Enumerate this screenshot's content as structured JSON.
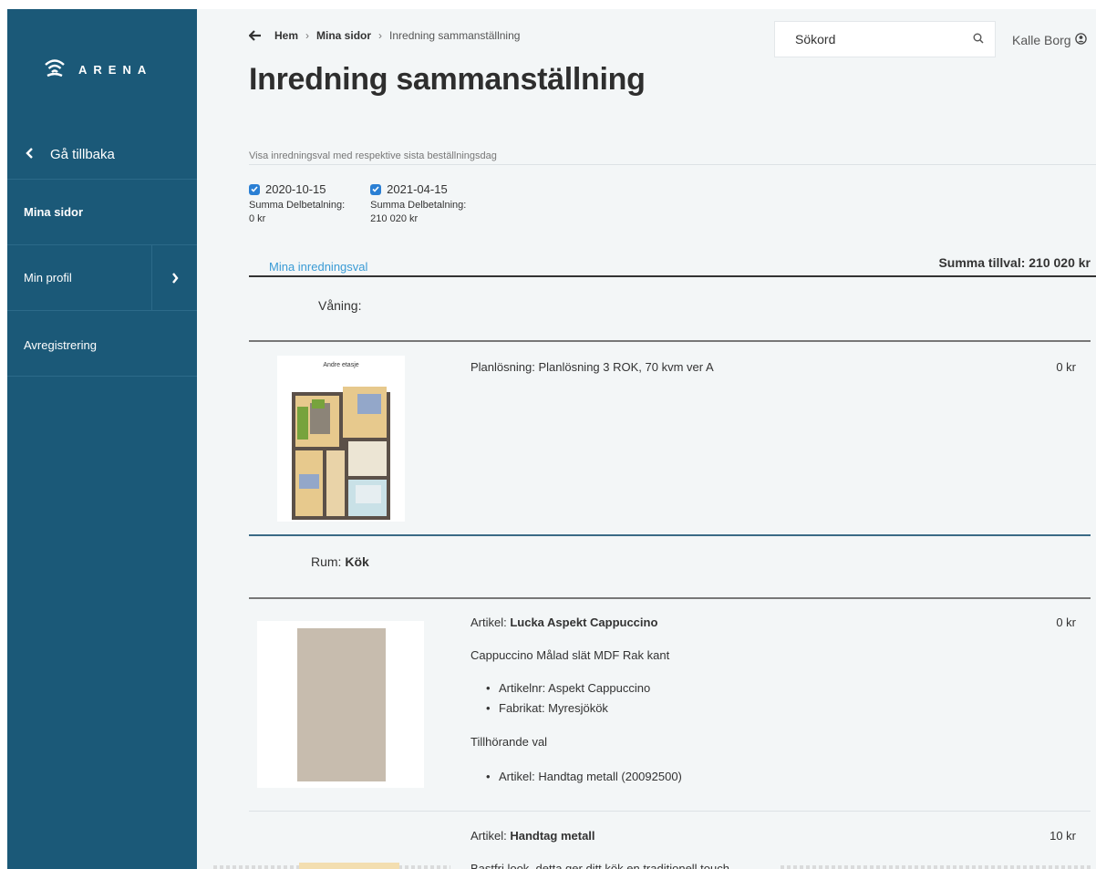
{
  "sidebar": {
    "brand": "ARENA",
    "back_label": "Gå tillbaka",
    "items": [
      {
        "label": "Mina sidor"
      },
      {
        "label": "Min profil"
      },
      {
        "label": "Avregistrering"
      }
    ]
  },
  "header": {
    "breadcrumb": [
      "Hem",
      "Mina sidor",
      "Inredning sammanställning"
    ],
    "search_placeholder": "Sökord",
    "user_name": "Kalle Borg",
    "page_title": "Inredning sammanställning"
  },
  "filters": {
    "subtitle": "Visa inredningsval med respektive sista beställningsdag",
    "dates": [
      {
        "date": "2020-10-15",
        "label": "Summa Delbetalning:",
        "amount": "0 kr",
        "checked": true
      },
      {
        "date": "2021-04-15",
        "label": "Summa Delbetalning:",
        "amount": "210 020 kr",
        "checked": true
      }
    ]
  },
  "selection": {
    "tab_label": "Mina inredningsval",
    "total": "Summa tillval: 210 020 kr",
    "floor_label": "Våning:",
    "floorplan": {
      "image_caption": "Andre etasje",
      "text": "Planlösning: Planlösning 3 ROK, 70 kvm ver A",
      "price": "0 kr"
    },
    "room_prefix": "Rum: ",
    "room_name": "Kök",
    "articles": [
      {
        "prefix": "Artikel: ",
        "name": "Lucka Aspekt Cappuccino",
        "price": "0 kr",
        "description": "Cappuccino Målad slät MDF Rak kant",
        "specs": [
          "Artikelnr: Aspekt Cappuccino",
          "Fabrikat: Myresjökök"
        ],
        "related_heading": "Tillhörande val",
        "related": [
          "Artikel: Handtag metall (20092500)"
        ]
      },
      {
        "prefix": "Artikel: ",
        "name": "Handtag metall",
        "price": "10 kr",
        "description": "Bastfri look, detta ger ditt kök en traditionell touch"
      }
    ]
  }
}
